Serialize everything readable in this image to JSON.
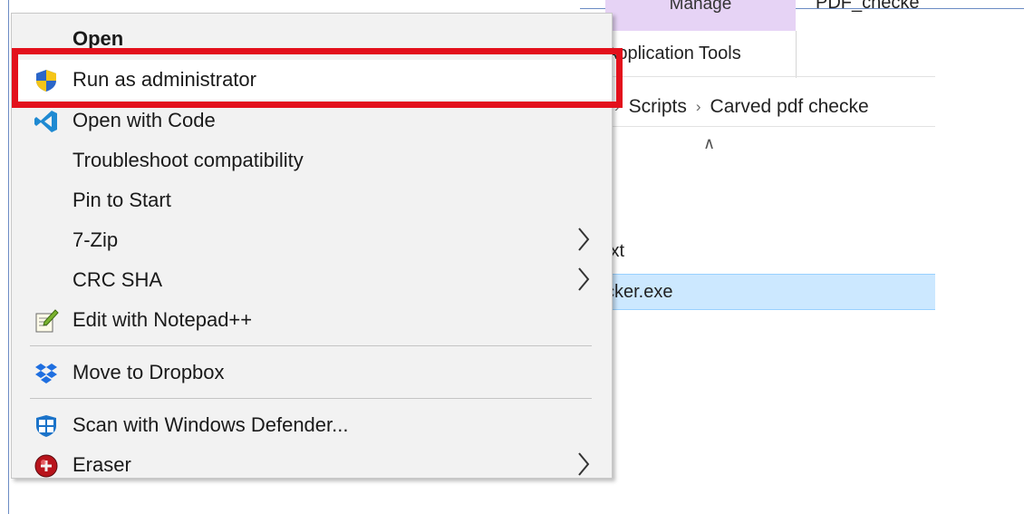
{
  "explorer": {
    "manage_tab": "Manage",
    "window_title": "PDF_checke",
    "app_tools_tab": "Application Tools",
    "breadcrumb": [
      "Scripts",
      "Carved pdf checke"
    ],
    "files": [
      "txt",
      "cker.exe"
    ]
  },
  "context_menu": {
    "items": [
      {
        "label": "Open",
        "icon": "none"
      },
      {
        "label": "Run as administrator",
        "icon": "uac-shield-icon"
      },
      {
        "label": "Open with Code",
        "icon": "vscode-icon"
      },
      {
        "label": "Troubleshoot compatibility",
        "icon": "none"
      },
      {
        "label": "Pin to Start",
        "icon": "none"
      },
      {
        "label": "7-Zip",
        "icon": "none",
        "submenu": true
      },
      {
        "label": "CRC SHA",
        "icon": "none",
        "submenu": true
      },
      {
        "label": "Edit with Notepad++",
        "icon": "notepadpp-icon"
      },
      {
        "label": "Move to Dropbox",
        "icon": "dropbox-icon"
      },
      {
        "label": "Scan with Windows Defender...",
        "icon": "defender-icon"
      },
      {
        "label": "Eraser",
        "icon": "eraser-icon",
        "submenu": true
      }
    ]
  },
  "colors": {
    "highlight": "#e3101c",
    "selection": "#cce8ff",
    "manage_tab": "#e6d3f5"
  }
}
